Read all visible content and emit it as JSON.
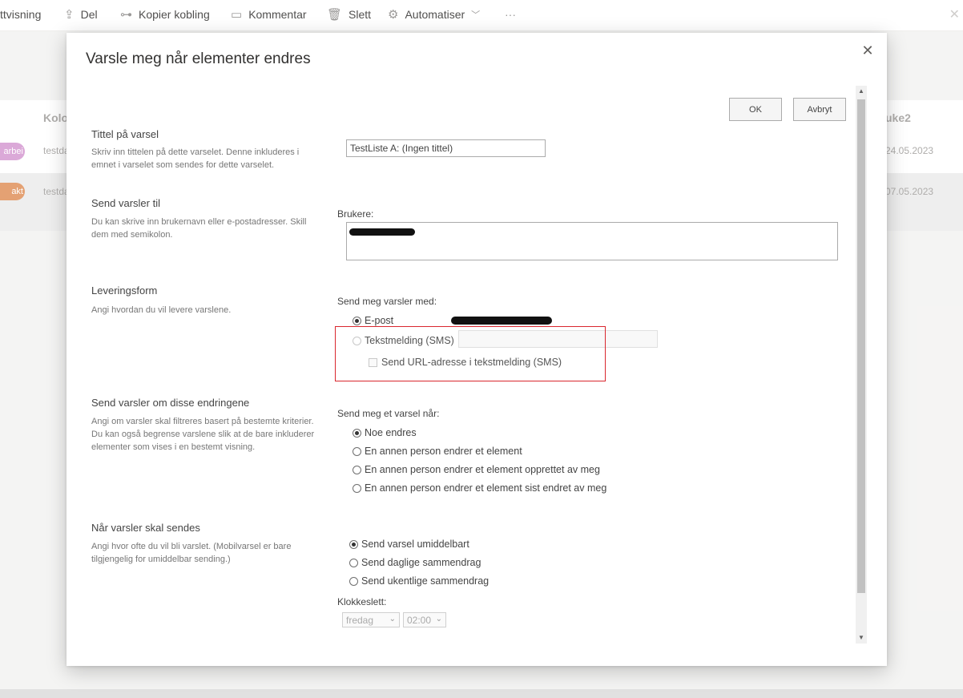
{
  "commandbar": {
    "items": [
      {
        "label": "ttvisning"
      },
      {
        "label": "Del",
        "icon": "share-icon"
      },
      {
        "label": "Kopier kobling",
        "icon": "link-icon"
      },
      {
        "label": "Kommentar",
        "icon": "comment-icon"
      },
      {
        "label": "Slett",
        "icon": "trash-icon"
      },
      {
        "label": "Automatiser",
        "icon": "automate-icon"
      }
    ],
    "more": "···"
  },
  "background_list": {
    "col_left": "Kolo",
    "col_right": "uke2",
    "rows": [
      {
        "badge": "arbei",
        "badge_color": "#d59ad2",
        "text": "testda",
        "date": "24.05.2023"
      },
      {
        "badge": "akt",
        "badge_color": "#e0915b",
        "text": "testda",
        "date": "07.05.2023"
      }
    ]
  },
  "dialog": {
    "title": "Varsle meg når elementer endres",
    "ok": "OK",
    "cancel": "Avbryt",
    "sections": {
      "title": {
        "heading": "Tittel på varsel",
        "desc": "Skriv inn tittelen på dette varselet. Denne inkluderes i emnet i varselet som sendes for dette varselet.",
        "value": "TestListe A: (Ingen tittel)"
      },
      "recipients": {
        "heading": "Send varsler til",
        "desc": "Du kan skrive inn brukernavn eller e-postadresser. Skill dem med semikolon.",
        "users_label": "Brukere:"
      },
      "delivery": {
        "heading": "Leveringsform",
        "desc": "Angi hvordan du vil levere varslene.",
        "label": "Send meg varsler med:",
        "email": "E-post",
        "sms": "Tekstmelding (SMS)",
        "sms_url": "Send URL-adresse i tekstmelding (SMS)"
      },
      "changes": {
        "heading": "Send varsler om disse endringene",
        "desc": "Angi om varsler skal filtreres basert på bestemte kriterier. Du kan også begrense varslene slik at de bare inkluderer elementer som vises i en bestemt visning.",
        "label": "Send meg et varsel når:",
        "options": [
          "Noe endres",
          "En annen person endrer et element",
          "En annen person endrer et element opprettet av meg",
          "En annen person endrer et element sist endret av meg"
        ]
      },
      "timing": {
        "heading": "Når varsler skal sendes",
        "desc": "Angi hvor ofte du vil bli varslet. (Mobilvarsel er bare tilgjengelig for umiddelbar sending.)",
        "options": [
          "Send varsel umiddelbart",
          "Send daglige sammendrag",
          "Send ukentlige sammendrag"
        ],
        "time_label": "Klokkeslett:",
        "day": "fredag",
        "time": "02:00"
      }
    }
  }
}
